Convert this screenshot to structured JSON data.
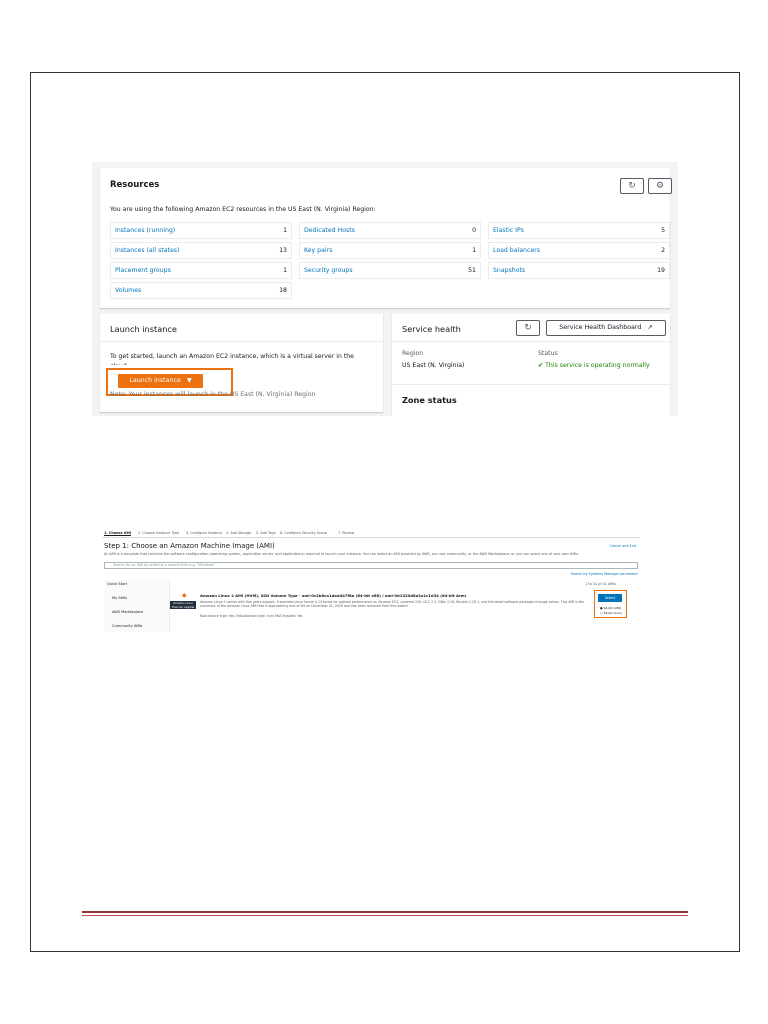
{
  "resources": {
    "title": "Resources",
    "refresh_icon": "refresh-icon",
    "settings_icon": "settings-icon",
    "subtitle": "You are using the following Amazon EC2 resources in the US East (N. Virginia) Region:",
    "items": [
      {
        "label": "Instances (running)",
        "value": "1"
      },
      {
        "label": "Dedicated Hosts",
        "value": "0"
      },
      {
        "label": "Elastic IPs",
        "value": "5"
      },
      {
        "label": "Instances (all states)",
        "value": "13"
      },
      {
        "label": "Key pairs",
        "value": "1"
      },
      {
        "label": "Load balancers",
        "value": "2"
      },
      {
        "label": "Placement groups",
        "value": "1"
      },
      {
        "label": "Security groups",
        "value": "51"
      },
      {
        "label": "Snapshots",
        "value": "19"
      },
      {
        "label": "Volumes",
        "value": "18"
      }
    ]
  },
  "launch": {
    "title": "Launch instance",
    "text": "To get started, launch an Amazon EC2 instance, which is a virtual server in the cloud.",
    "button": "Launch instance",
    "button_arrow": "▼",
    "note": "Note: Your instances will launch in the US East (N. Virginia) Region",
    "accent": "#ec7211"
  },
  "health": {
    "title": "Service health",
    "dashboard_button": "Service Health Dashboard",
    "region_label": "Region",
    "region_value": "US East (N. Virginia)",
    "status_label": "Status",
    "status_value": "This service is operating normally",
    "status_color": "#1d8102",
    "zone_title": "Zone status"
  },
  "wizard": {
    "steps": [
      "1. Choose AMI",
      "2. Choose Instance Type",
      "3. Configure Instance",
      "4. Add Storage",
      "5. Add Tags",
      "6. Configure Security Group",
      "7. Review"
    ],
    "title": "Step 1: Choose an Amazon Machine Image (AMI)",
    "description": "An AMI is a template that contains the software configuration (operating system, application server, and applications) required to launch your instance. You can select an AMI provided by AWS, our user community, or the AWS Marketplace; or you can select one of your own AMIs.",
    "cancel": "Cancel and Exit",
    "search_placeholder": "Search for an AMI by entering a search term e.g. \"Windows\"",
    "search_right": "Search by Systems Manager parameter",
    "sidebar_head": "Quick Start",
    "sidebar_items": [
      "My AMIs",
      "AWS Marketplace",
      "Community AMIs"
    ],
    "pager": "1 to 41 of 41 AMIs",
    "ami_title": "Amazon Linux 2 AMI (HVM), SSD Volume Type - ami-0c2b8ca1dad447f8a (64-bit x86) / ami-0d1320d8a3a1c1d34 (64-bit Arm)",
    "ami_desc": "Amazon Linux 2 comes with five years support. It provides Linux kernel 4.14 tuned for optimal performance on Amazon EC2, systemd 219, GCC 7.3, Glibc 2.26, Binutils 2.29.1, and the latest software packages through extras. This AMI is the successor of the Amazon Linux AMI that is approaching end of life on December 31, 2020 and has been removed from this wizard.",
    "ami_meta": "Root device type: ebs    Virtualization type: hvm    ENA Enabled: Yes",
    "badge": "Amazon Linux Free tier eligible",
    "select": "Select",
    "radio_1": "64-bit (x86)",
    "radio_2": "64-bit (Arm)"
  }
}
